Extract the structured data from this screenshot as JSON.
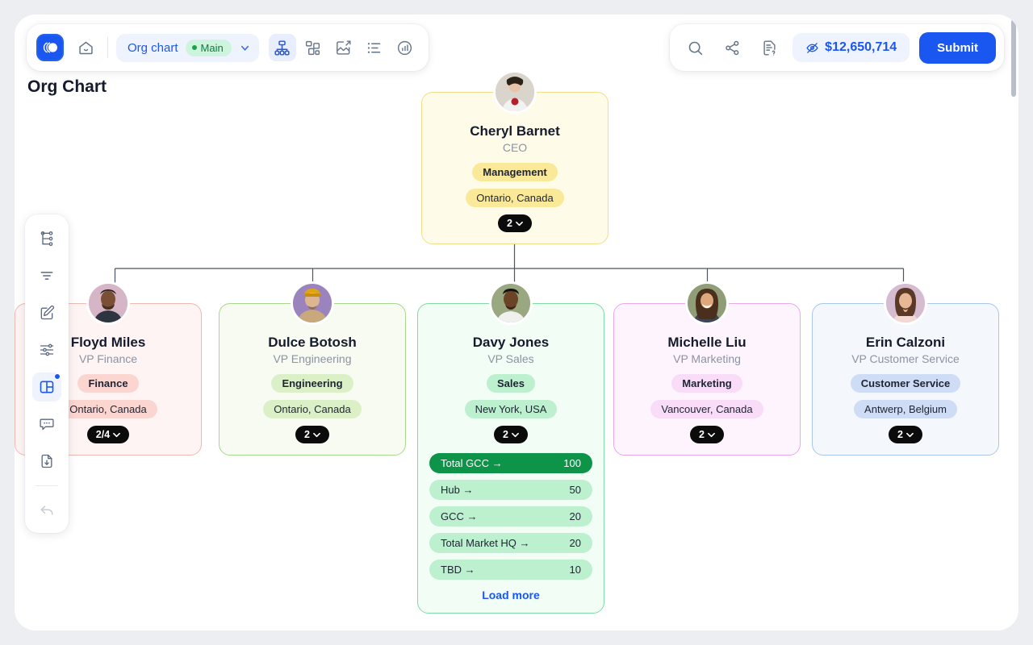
{
  "page": {
    "title": "Org Chart",
    "background": "#eceef1"
  },
  "toolbar": {
    "logo_icon": "app-logo-icon",
    "home_icon": "home-icon",
    "chart_selector": {
      "name": "Org chart",
      "branch": "Main",
      "branch_color": "#16a34a",
      "chevron_icon": "chevron-down-icon"
    },
    "views": [
      {
        "id": "org-chart",
        "icon": "org-chart-icon",
        "active": true
      },
      {
        "id": "grouped",
        "icon": "grouped-nodes-icon",
        "active": false
      },
      {
        "id": "export-image",
        "icon": "image-export-icon",
        "active": false
      },
      {
        "id": "list",
        "icon": "list-view-icon",
        "active": false
      },
      {
        "id": "analytics",
        "icon": "analytics-icon",
        "active": false
      }
    ]
  },
  "top_right": {
    "search_icon": "search-icon",
    "share_icon": "share-icon",
    "help_doc_icon": "document-help-icon",
    "budget": {
      "icon": "eye-off-icon",
      "amount": "$12,650,714",
      "color": "#1a56f0"
    },
    "submit_label": "Submit",
    "submit_color": "#1a56f0"
  },
  "left_rail": {
    "items": [
      {
        "id": "hierarchy",
        "icon": "hierarchy-icon",
        "active": false,
        "dot": false
      },
      {
        "id": "filter",
        "icon": "filter-lines-icon",
        "active": false,
        "dot": false
      },
      {
        "id": "edit",
        "icon": "edit-square-icon",
        "active": false,
        "dot": false
      },
      {
        "id": "settings-sliders",
        "icon": "sliders-icon",
        "active": false,
        "dot": false
      },
      {
        "id": "panel-layout",
        "icon": "panel-layout-icon",
        "active": true,
        "dot": true
      },
      {
        "id": "comments",
        "icon": "comment-icon",
        "active": false,
        "dot": false
      },
      {
        "id": "download",
        "icon": "file-download-icon",
        "active": false,
        "dot": false
      },
      {
        "id": "undo",
        "icon": "undo-arrow-icon",
        "active": false,
        "dot": false
      }
    ]
  },
  "org_chart": {
    "root": {
      "name": "Cheryl Barnet",
      "role": "CEO",
      "department": "Management",
      "location": "Ontario, Canada",
      "count": "2",
      "colors": {
        "bg": "#fefce8",
        "border": "#f3dd8a",
        "tag_bg": "#fbe99a",
        "loc_bg": "#fbe99a"
      },
      "avatar_bg": "#d9d5cc"
    },
    "children": [
      {
        "name": "Floyd Miles",
        "role": "VP Finance",
        "department": "Finance",
        "location": "Ontario, Canada",
        "count": "2/4",
        "colors": {
          "bg": "#fdf4f3",
          "border": "#f0b9b2",
          "tag_bg": "#fbd6d1",
          "loc_bg": "#fbd6d1"
        },
        "avatar_bg": "#d6b6c6"
      },
      {
        "name": "Dulce Botosh",
        "role": "VP Engineering",
        "department": "Engineering",
        "location": "Ontario, Canada",
        "count": "2",
        "colors": {
          "bg": "#f7fbf2",
          "border": "#a7d88b",
          "tag_bg": "#dcf0c8",
          "loc_bg": "#dcf0c8"
        },
        "avatar_bg": "#9b84bd"
      },
      {
        "name": "Davy Jones",
        "role": "VP Sales",
        "department": "Sales",
        "location": "New York, USA",
        "count": "2",
        "colors": {
          "bg": "#f2fdf6",
          "border": "#7fdca4",
          "tag_bg": "#bdf0cf",
          "loc_bg": "#bdf0cf"
        },
        "avatar_bg": "#9aa882",
        "metrics": [
          {
            "label": "Total GCC →",
            "value": "100",
            "highlight": true
          },
          {
            "label": "Hub →",
            "value": "50",
            "highlight": false
          },
          {
            "label": "GCC →",
            "value": "20",
            "highlight": false
          },
          {
            "label": "Total Market HQ →",
            "value": "20",
            "highlight": false
          },
          {
            "label": "TBD →",
            "value": "10",
            "highlight": false
          }
        ],
        "load_more_label": "Load more"
      },
      {
        "name": "Michelle Liu",
        "role": "VP Marketing",
        "department": "Marketing",
        "location": "Vancouver, Canada",
        "count": "2",
        "colors": {
          "bg": "#fdf4fd",
          "border": "#eaa8ea",
          "tag_bg": "#f8dcf8",
          "loc_bg": "#f8dcf8"
        },
        "avatar_bg": "#8f9e77"
      },
      {
        "name": "Erin Calzoni",
        "role": "VP Customer Service",
        "department": "Customer Service",
        "location": "Antwerp, Belgium",
        "count": "2",
        "colors": {
          "bg": "#f4f8fd",
          "border": "#a9c6ec",
          "tag_bg": "#cfdcf6",
          "loc_bg": "#cfdcf6"
        },
        "avatar_bg": "#d5bcd0"
      }
    ],
    "chevron_icon": "chevron-down-icon"
  }
}
